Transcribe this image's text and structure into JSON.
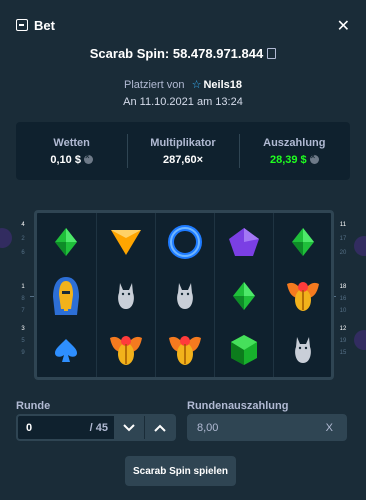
{
  "header": {
    "title": "Bet",
    "close_icon": "close-icon"
  },
  "spin": {
    "title": "Scarab Spin: 58.478.971.844",
    "placed_prefix": "Platziert von",
    "user": "Neils18",
    "date": "An 11.10.2021 am 13:24"
  },
  "stats": [
    {
      "label": "Wetten",
      "value": "0,10 $"
    },
    {
      "label": "Multiplikator",
      "value": "287,60×"
    },
    {
      "label": "Auszahlung",
      "value": "28,39 $"
    }
  ],
  "board": {
    "paylines_left": [
      "4",
      "2",
      "6",
      "1",
      "8",
      "7",
      "3",
      "5",
      "9"
    ],
    "paylines_right": [
      "11",
      "17",
      "20",
      "18",
      "16",
      "10",
      "12",
      "19",
      "15"
    ],
    "reels": [
      [
        "green-diamond",
        "pharaoh-mask",
        "blue-spade"
      ],
      [
        "orange-triangle",
        "white-cat",
        "golden-scarab"
      ],
      [
        "blue-ring",
        "white-cat",
        "golden-scarab"
      ],
      [
        "purple-pentagon",
        "green-diamond",
        "green-hexagon"
      ],
      [
        "green-diamond",
        "golden-scarab",
        "white-cat"
      ]
    ]
  },
  "controls": {
    "round_label": "Runde",
    "round_value": "0",
    "round_total": "/ 45",
    "payout_label": "Rundenauszahlung",
    "payout_value": "8,00",
    "payout_clear": "X",
    "play_button": "Scarab Spin spielen"
  },
  "colors": {
    "background": "#1a2c38",
    "panel": "#0f212e",
    "border": "#2f4553",
    "green": "#1fff20",
    "link_star": "#37b7ff"
  }
}
